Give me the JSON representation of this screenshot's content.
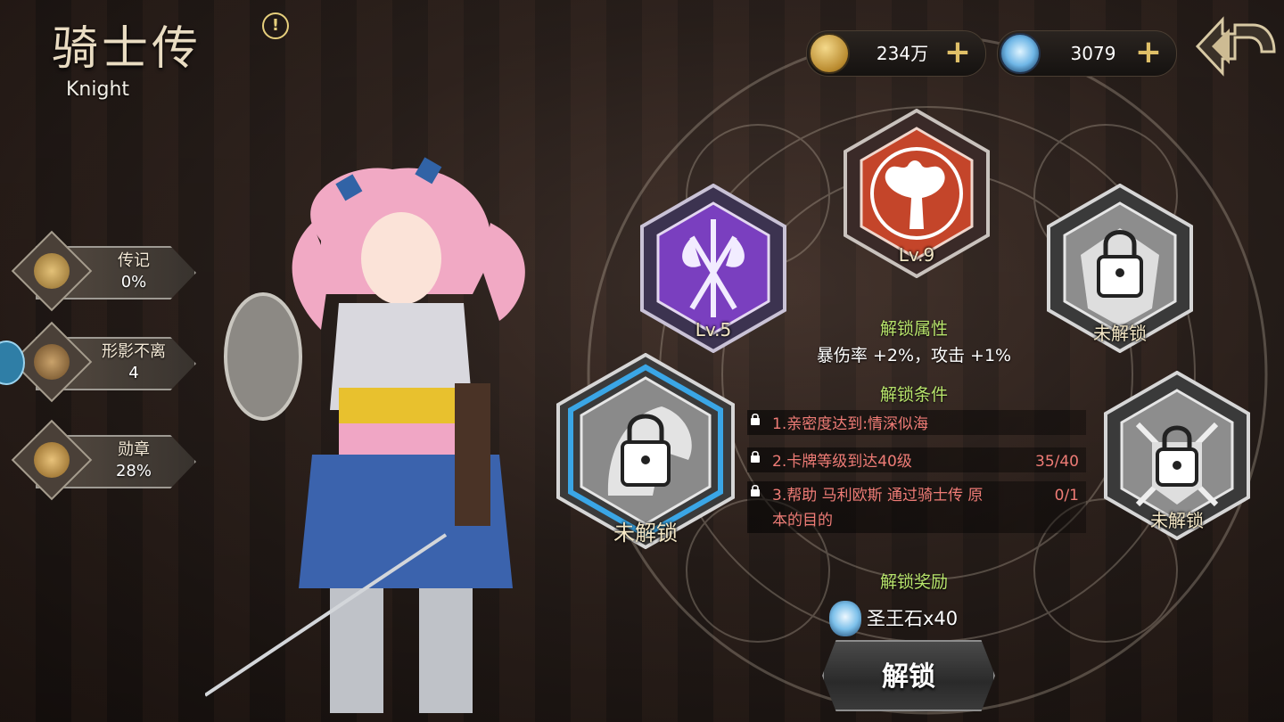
{
  "header": {
    "title": "骑士传",
    "subtitle": "Knight",
    "info_glyph": "!"
  },
  "currency": {
    "gold": {
      "value": "234万",
      "icon": "coin-icon"
    },
    "gem": {
      "value": "3079",
      "icon": "gem-icon"
    },
    "plus": "+"
  },
  "sidebar": {
    "items": [
      {
        "label": "传记",
        "value": "0%",
        "icon": "horse-emblem-icon"
      },
      {
        "label": "形影不离",
        "value": "4",
        "icon": "heart-icon"
      },
      {
        "label": "勋章",
        "value": "28%",
        "icon": "medal-icon"
      }
    ]
  },
  "nodes": {
    "axe": {
      "label": "Lv.5",
      "color": "#7a3fbf"
    },
    "tree": {
      "label": "Lv.9",
      "color": "#c4452a"
    },
    "locked_top_right": {
      "label": "未解锁"
    },
    "knight_selected": {
      "label": "未解锁",
      "ring": "#3aa6e6"
    },
    "locked_bottom_right": {
      "label": "未解锁"
    }
  },
  "panel": {
    "attr_title": "解锁属性",
    "attr_text": "暴伤率 +2%，攻击 +1%",
    "cond_title": "解锁条件",
    "conditions": [
      {
        "text": "1.亲密度达到:情深似海",
        "progress": ""
      },
      {
        "text": "2.卡牌等级到达40级",
        "progress": "35/40"
      },
      {
        "text": "3.帮助 马利欧斯 通过骑士传 原",
        "text2": "本的目的",
        "progress": "0/1"
      }
    ],
    "reward_title": "解锁奖励",
    "reward_text": "圣王石x40",
    "unlock_button": "解锁"
  },
  "colors": {
    "accent_gold": "#e0c068",
    "condition_red": "#ef7c76",
    "title_green": "#b7e36b"
  }
}
